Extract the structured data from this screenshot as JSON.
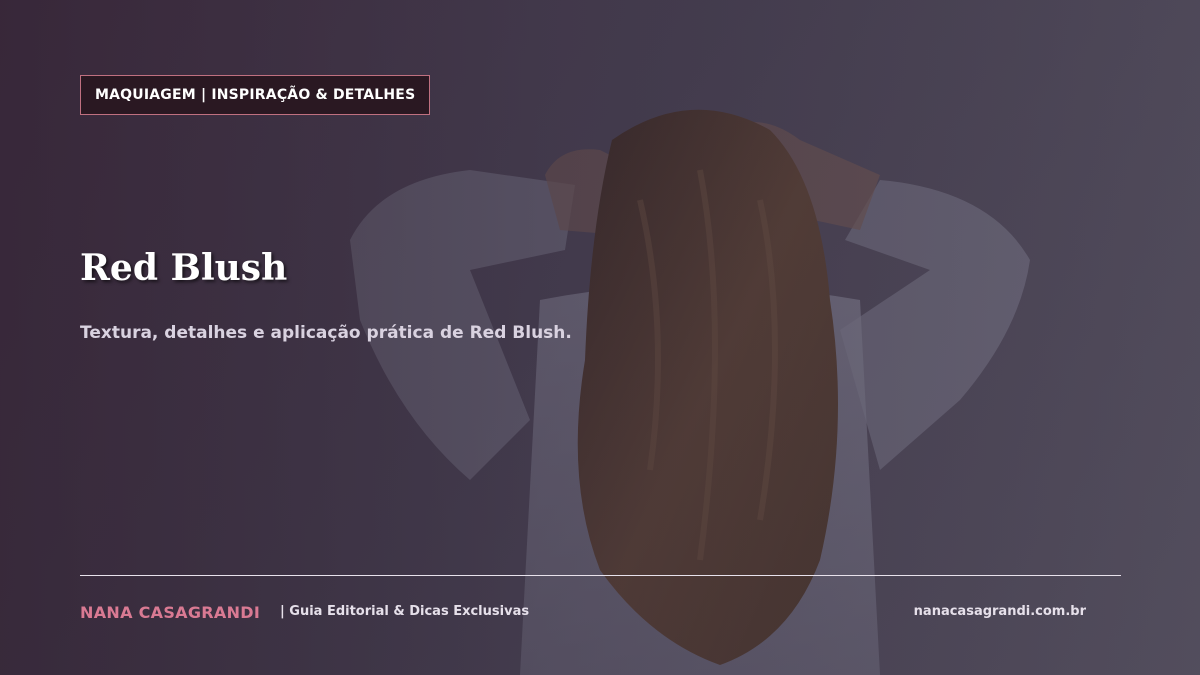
{
  "hero": {
    "category_badge": "MAQUIAGEM | INSPIRAÇÃO & DETALHES",
    "title": "Red Blush",
    "subtitle": "Textura, detalhes e aplicação prática de Red Blush."
  },
  "footer": {
    "brand": "NANA CASAGRANDI",
    "tagline": "| Guia Editorial & Dicas Exclusivas",
    "website": "nanacasagrandi.com.br"
  },
  "colors": {
    "badge_background": "#2a1822",
    "badge_border": "#c07080",
    "brand_accent": "#d97a93",
    "divider": "#e8e2ec"
  }
}
